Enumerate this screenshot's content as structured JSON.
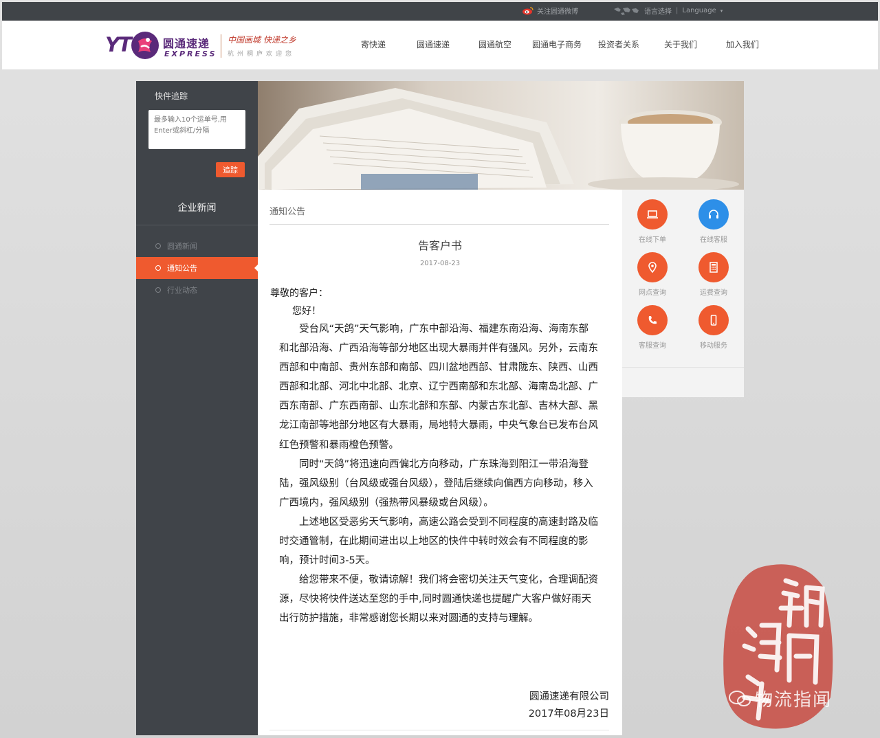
{
  "topbar": {
    "weibo_label": "关注圆通微博",
    "lang_label": "语言选择",
    "lang_value": "Language"
  },
  "logo": {
    "mark": "YT",
    "name_cn": "圆通速递",
    "name_en": "EXPRESS",
    "slogan": "中国画城 快递之乡",
    "slogan_sub": "杭州桐庐欢迎您"
  },
  "nav": [
    "寄快递",
    "圆通速递",
    "圆通航空",
    "圆通电子商务",
    "投资者关系",
    "关于我们",
    "加入我们"
  ],
  "sidebar": {
    "track_title": "快件追踪",
    "track_placeholder": "最多输入10个运单号,用Enter或斜杠/分隔",
    "track_button": "追踪",
    "news_heading": "企业新闻",
    "items": [
      {
        "label": "圆通新闻",
        "active": false
      },
      {
        "label": "通知公告",
        "active": true
      },
      {
        "label": "行业动态",
        "active": false
      }
    ]
  },
  "article": {
    "breadcrumb": "通知公告",
    "title": "告客户书",
    "date": "2017-08-23",
    "salutation": "尊敬的客户：",
    "greeting": "您好！",
    "paragraphs": [
      "受台风“天鸽”天气影响，广东中部沿海、福建东南沿海、海南东部和北部沿海、广西沿海等部分地区出现大暴雨并伴有强风。另外，云南东西部和中南部、贵州东部和南部、四川盆地西部、甘肃陇东、陕西、山西西部和北部、河北中北部、北京、辽宁西南部和东北部、海南岛北部、广西东南部、广东西南部、山东北部和东部、内蒙古东北部、吉林大部、黑龙江南部等地部分地区有大暴雨，局地特大暴雨，中央气象台已发布台风红色预警和暴雨橙色预警。",
      "同时“天鸽”将迅速向西偏北方向移动，广东珠海到阳江一带沿海登陆，强风级别（台风级或强台风级），登陆后继续向偏西方向移动，移入广西境内，强风级别（强热带风暴级或台风级）。",
      "上述地区受恶劣天气影响，高速公路会受到不同程度的高速封路及临时交通管制，在此期间进出以上地区的快件中转时效会有不同程度的影响，预计时间3-5天。",
      "给您带来不便，敬请谅解！我们将会密切关注天气变化，合理调配资源，尽快将快件送达至您的手中,同时圆通快递也提醒广大客户做好雨天出行防护措施，非常感谢您长期以来对圆通的支持与理解。"
    ],
    "signature_company": "圆通速递有限公司",
    "signature_date": "2017年08月23日"
  },
  "quick_services": [
    {
      "label": "在线下单",
      "icon": "laptop-icon",
      "color": "#ef5a2f"
    },
    {
      "label": "在线客服",
      "icon": "headphones-icon",
      "color": "#2d8fe8"
    },
    {
      "label": "网点查询",
      "icon": "location-pin-icon",
      "color": "#ef5a2f"
    },
    {
      "label": "运费查询",
      "icon": "calculator-icon",
      "color": "#ef5a2f"
    },
    {
      "label": "客服查询",
      "icon": "phone-icon",
      "color": "#ef5a2f"
    },
    {
      "label": "移动服务",
      "icon": "mobile-icon",
      "color": "#ef5a2f"
    }
  ],
  "watermark": {
    "stamp_text": "订阅海运",
    "account": "物流指闻"
  },
  "colors": {
    "accent": "#ef5a2f",
    "sidebar": "#404449",
    "brand": "#5a2a7a",
    "blue": "#2d8fe8"
  }
}
